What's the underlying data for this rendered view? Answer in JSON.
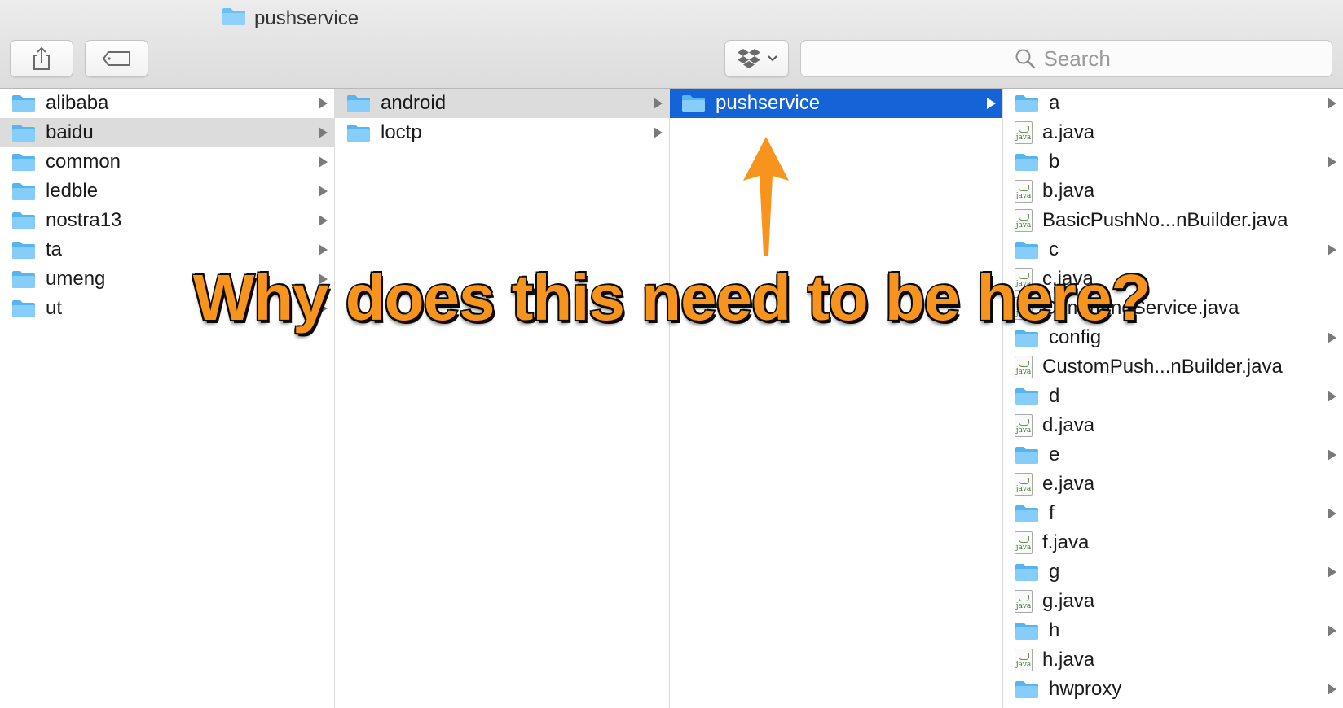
{
  "window": {
    "title": "pushservice"
  },
  "toolbar": {
    "share_icon": "share-icon",
    "tag_icon": "tag-icon",
    "dropbox_icon": "dropbox-icon"
  },
  "search": {
    "placeholder": "Search"
  },
  "columns": {
    "col1": [
      {
        "name": "alibaba",
        "type": "folder",
        "has_children": true
      },
      {
        "name": "baidu",
        "type": "folder",
        "has_children": true,
        "selected": "inactive"
      },
      {
        "name": "common",
        "type": "folder",
        "has_children": true
      },
      {
        "name": "ledble",
        "type": "folder",
        "has_children": true
      },
      {
        "name": "nostra13",
        "type": "folder",
        "has_children": true
      },
      {
        "name": "ta",
        "type": "folder",
        "has_children": true
      },
      {
        "name": "umeng",
        "type": "folder",
        "has_children": true
      },
      {
        "name": "ut",
        "type": "folder",
        "has_children": true
      }
    ],
    "col2": [
      {
        "name": "android",
        "type": "folder",
        "has_children": true,
        "selected": "inactive"
      },
      {
        "name": "loctp",
        "type": "folder",
        "has_children": true
      }
    ],
    "col3": [
      {
        "name": "pushservice",
        "type": "folder",
        "has_children": true,
        "selected": "active"
      }
    ],
    "col4": [
      {
        "name": "a",
        "type": "folder",
        "has_children": true
      },
      {
        "name": "a.java",
        "type": "java"
      },
      {
        "name": "b",
        "type": "folder",
        "has_children": true
      },
      {
        "name": "b.java",
        "type": "java"
      },
      {
        "name": "BasicPushNo...nBuilder.java",
        "type": "java"
      },
      {
        "name": "c",
        "type": "folder",
        "has_children": true
      },
      {
        "name": "c.java",
        "type": "java"
      },
      {
        "name": "CommandService.java",
        "type": "java"
      },
      {
        "name": "config",
        "type": "folder",
        "has_children": true
      },
      {
        "name": "CustomPush...nBuilder.java",
        "type": "java"
      },
      {
        "name": "d",
        "type": "folder",
        "has_children": true
      },
      {
        "name": "d.java",
        "type": "java"
      },
      {
        "name": "e",
        "type": "folder",
        "has_children": true
      },
      {
        "name": "e.java",
        "type": "java"
      },
      {
        "name": "f",
        "type": "folder",
        "has_children": true
      },
      {
        "name": "f.java",
        "type": "java"
      },
      {
        "name": "g",
        "type": "folder",
        "has_children": true
      },
      {
        "name": "g.java",
        "type": "java"
      },
      {
        "name": "h",
        "type": "folder",
        "has_children": true
      },
      {
        "name": "h.java",
        "type": "java"
      },
      {
        "name": "hwproxy",
        "type": "folder",
        "has_children": true
      }
    ]
  },
  "annotation": {
    "text": "Why does this need to be here?",
    "color": "#f7941d"
  },
  "colors": {
    "selection_active": "#1464d7",
    "selection_inactive": "#dcdcdc",
    "folder": "#6cc0f5"
  }
}
